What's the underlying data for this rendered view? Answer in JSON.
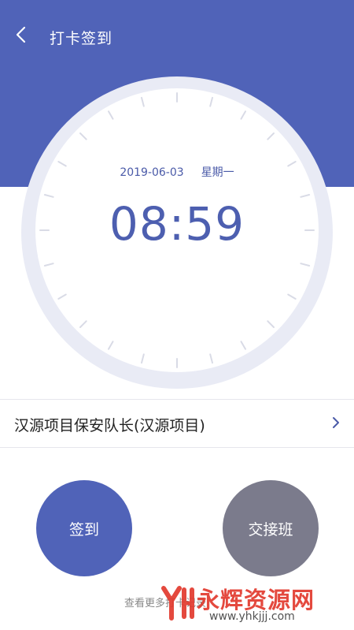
{
  "header": {
    "title": "打卡签到",
    "background_color": "#5063b8",
    "back_icon": "chevron-left-icon"
  },
  "clock": {
    "date": "2019-06-03",
    "weekday": "星期一",
    "time": "08:59",
    "text_color": "#4d5fb0"
  },
  "project": {
    "label": "汉源项目保安队长(汉源项目)",
    "arrow_icon": "chevron-right-icon"
  },
  "actions": {
    "signin_label": "签到",
    "signin_color": "#5063b8",
    "handover_label": "交接班",
    "handover_color": "#7b7b8c"
  },
  "footer": {
    "more_records": "查看更多打卡记录"
  },
  "watermark": {
    "text": "永辉资源网",
    "url": "www.yhkjjj.com",
    "color": "#e23a2e"
  }
}
